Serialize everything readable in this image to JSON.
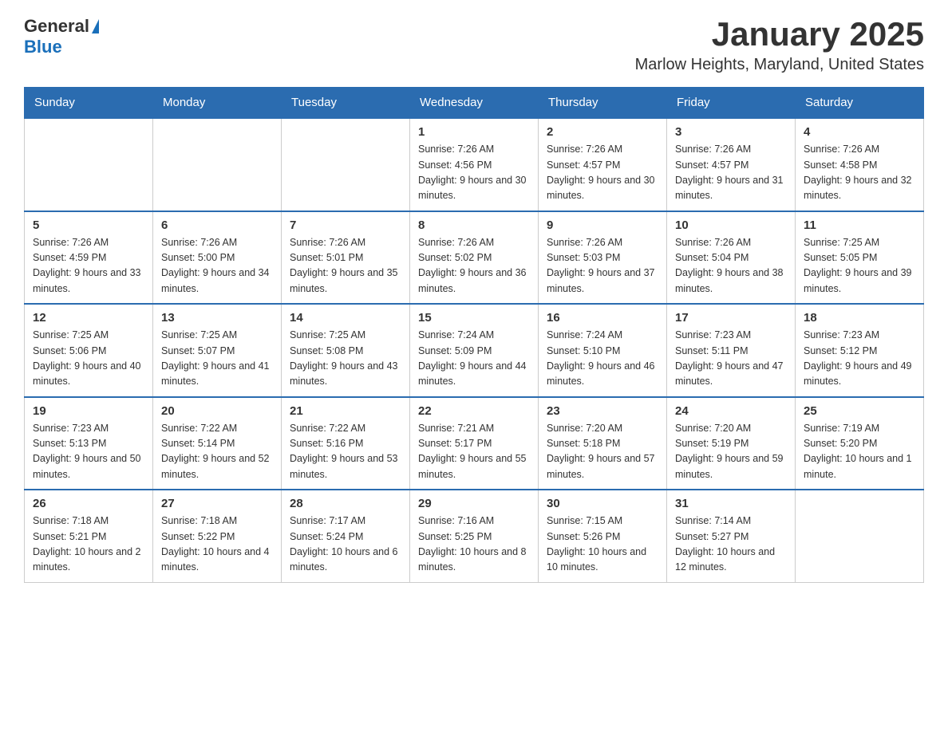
{
  "header": {
    "logo": {
      "general": "General",
      "blue": "Blue"
    },
    "title": "January 2025",
    "subtitle": "Marlow Heights, Maryland, United States"
  },
  "calendar": {
    "days_of_week": [
      "Sunday",
      "Monday",
      "Tuesday",
      "Wednesday",
      "Thursday",
      "Friday",
      "Saturday"
    ],
    "weeks": [
      [
        {
          "day": "",
          "info": ""
        },
        {
          "day": "",
          "info": ""
        },
        {
          "day": "",
          "info": ""
        },
        {
          "day": "1",
          "info": "Sunrise: 7:26 AM\nSunset: 4:56 PM\nDaylight: 9 hours\nand 30 minutes."
        },
        {
          "day": "2",
          "info": "Sunrise: 7:26 AM\nSunset: 4:57 PM\nDaylight: 9 hours\nand 30 minutes."
        },
        {
          "day": "3",
          "info": "Sunrise: 7:26 AM\nSunset: 4:57 PM\nDaylight: 9 hours\nand 31 minutes."
        },
        {
          "day": "4",
          "info": "Sunrise: 7:26 AM\nSunset: 4:58 PM\nDaylight: 9 hours\nand 32 minutes."
        }
      ],
      [
        {
          "day": "5",
          "info": "Sunrise: 7:26 AM\nSunset: 4:59 PM\nDaylight: 9 hours\nand 33 minutes."
        },
        {
          "day": "6",
          "info": "Sunrise: 7:26 AM\nSunset: 5:00 PM\nDaylight: 9 hours\nand 34 minutes."
        },
        {
          "day": "7",
          "info": "Sunrise: 7:26 AM\nSunset: 5:01 PM\nDaylight: 9 hours\nand 35 minutes."
        },
        {
          "day": "8",
          "info": "Sunrise: 7:26 AM\nSunset: 5:02 PM\nDaylight: 9 hours\nand 36 minutes."
        },
        {
          "day": "9",
          "info": "Sunrise: 7:26 AM\nSunset: 5:03 PM\nDaylight: 9 hours\nand 37 minutes."
        },
        {
          "day": "10",
          "info": "Sunrise: 7:26 AM\nSunset: 5:04 PM\nDaylight: 9 hours\nand 38 minutes."
        },
        {
          "day": "11",
          "info": "Sunrise: 7:25 AM\nSunset: 5:05 PM\nDaylight: 9 hours\nand 39 minutes."
        }
      ],
      [
        {
          "day": "12",
          "info": "Sunrise: 7:25 AM\nSunset: 5:06 PM\nDaylight: 9 hours\nand 40 minutes."
        },
        {
          "day": "13",
          "info": "Sunrise: 7:25 AM\nSunset: 5:07 PM\nDaylight: 9 hours\nand 41 minutes."
        },
        {
          "day": "14",
          "info": "Sunrise: 7:25 AM\nSunset: 5:08 PM\nDaylight: 9 hours\nand 43 minutes."
        },
        {
          "day": "15",
          "info": "Sunrise: 7:24 AM\nSunset: 5:09 PM\nDaylight: 9 hours\nand 44 minutes."
        },
        {
          "day": "16",
          "info": "Sunrise: 7:24 AM\nSunset: 5:10 PM\nDaylight: 9 hours\nand 46 minutes."
        },
        {
          "day": "17",
          "info": "Sunrise: 7:23 AM\nSunset: 5:11 PM\nDaylight: 9 hours\nand 47 minutes."
        },
        {
          "day": "18",
          "info": "Sunrise: 7:23 AM\nSunset: 5:12 PM\nDaylight: 9 hours\nand 49 minutes."
        }
      ],
      [
        {
          "day": "19",
          "info": "Sunrise: 7:23 AM\nSunset: 5:13 PM\nDaylight: 9 hours\nand 50 minutes."
        },
        {
          "day": "20",
          "info": "Sunrise: 7:22 AM\nSunset: 5:14 PM\nDaylight: 9 hours\nand 52 minutes."
        },
        {
          "day": "21",
          "info": "Sunrise: 7:22 AM\nSunset: 5:16 PM\nDaylight: 9 hours\nand 53 minutes."
        },
        {
          "day": "22",
          "info": "Sunrise: 7:21 AM\nSunset: 5:17 PM\nDaylight: 9 hours\nand 55 minutes."
        },
        {
          "day": "23",
          "info": "Sunrise: 7:20 AM\nSunset: 5:18 PM\nDaylight: 9 hours\nand 57 minutes."
        },
        {
          "day": "24",
          "info": "Sunrise: 7:20 AM\nSunset: 5:19 PM\nDaylight: 9 hours\nand 59 minutes."
        },
        {
          "day": "25",
          "info": "Sunrise: 7:19 AM\nSunset: 5:20 PM\nDaylight: 10 hours\nand 1 minute."
        }
      ],
      [
        {
          "day": "26",
          "info": "Sunrise: 7:18 AM\nSunset: 5:21 PM\nDaylight: 10 hours\nand 2 minutes."
        },
        {
          "day": "27",
          "info": "Sunrise: 7:18 AM\nSunset: 5:22 PM\nDaylight: 10 hours\nand 4 minutes."
        },
        {
          "day": "28",
          "info": "Sunrise: 7:17 AM\nSunset: 5:24 PM\nDaylight: 10 hours\nand 6 minutes."
        },
        {
          "day": "29",
          "info": "Sunrise: 7:16 AM\nSunset: 5:25 PM\nDaylight: 10 hours\nand 8 minutes."
        },
        {
          "day": "30",
          "info": "Sunrise: 7:15 AM\nSunset: 5:26 PM\nDaylight: 10 hours\nand 10 minutes."
        },
        {
          "day": "31",
          "info": "Sunrise: 7:14 AM\nSunset: 5:27 PM\nDaylight: 10 hours\nand 12 minutes."
        },
        {
          "day": "",
          "info": ""
        }
      ]
    ]
  }
}
